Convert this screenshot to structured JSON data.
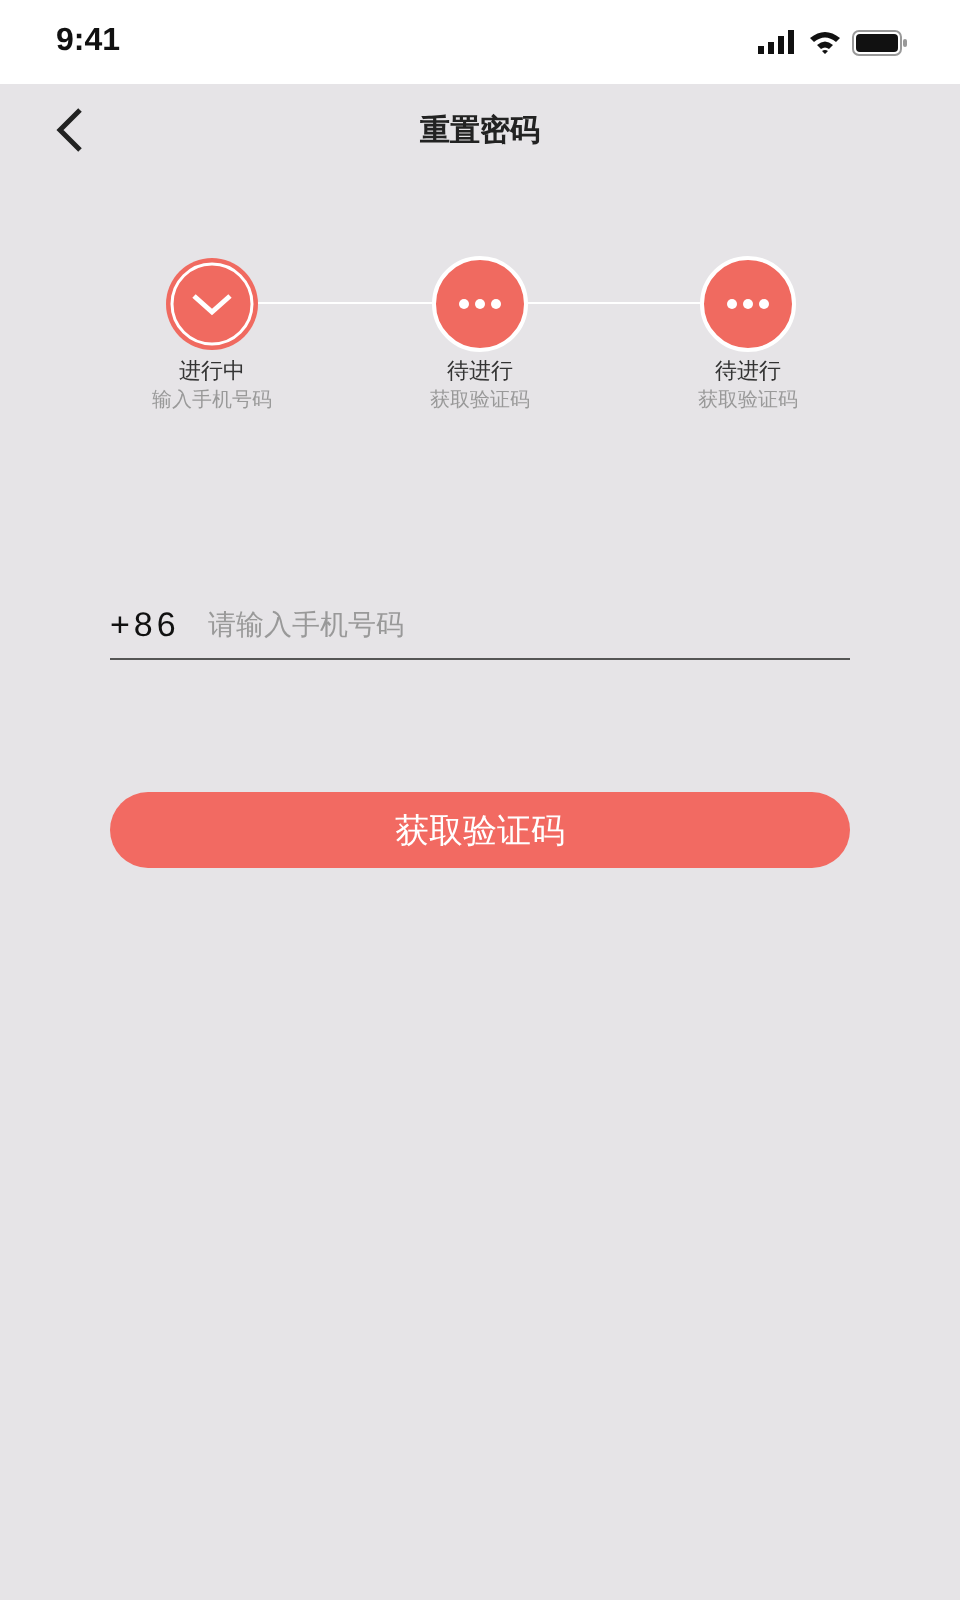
{
  "status_bar": {
    "time": "9:41"
  },
  "nav": {
    "title": "重置密码"
  },
  "steps": [
    {
      "kind": "current",
      "label": "进行中",
      "caption": "输入手机号码"
    },
    {
      "kind": "pending",
      "label": "待进行",
      "caption": "获取验证码"
    },
    {
      "kind": "pending",
      "label": "待进行",
      "caption": "获取验证码"
    }
  ],
  "phone": {
    "prefix": "+86",
    "placeholder": "请输入手机号码"
  },
  "button": "获取验证码"
}
